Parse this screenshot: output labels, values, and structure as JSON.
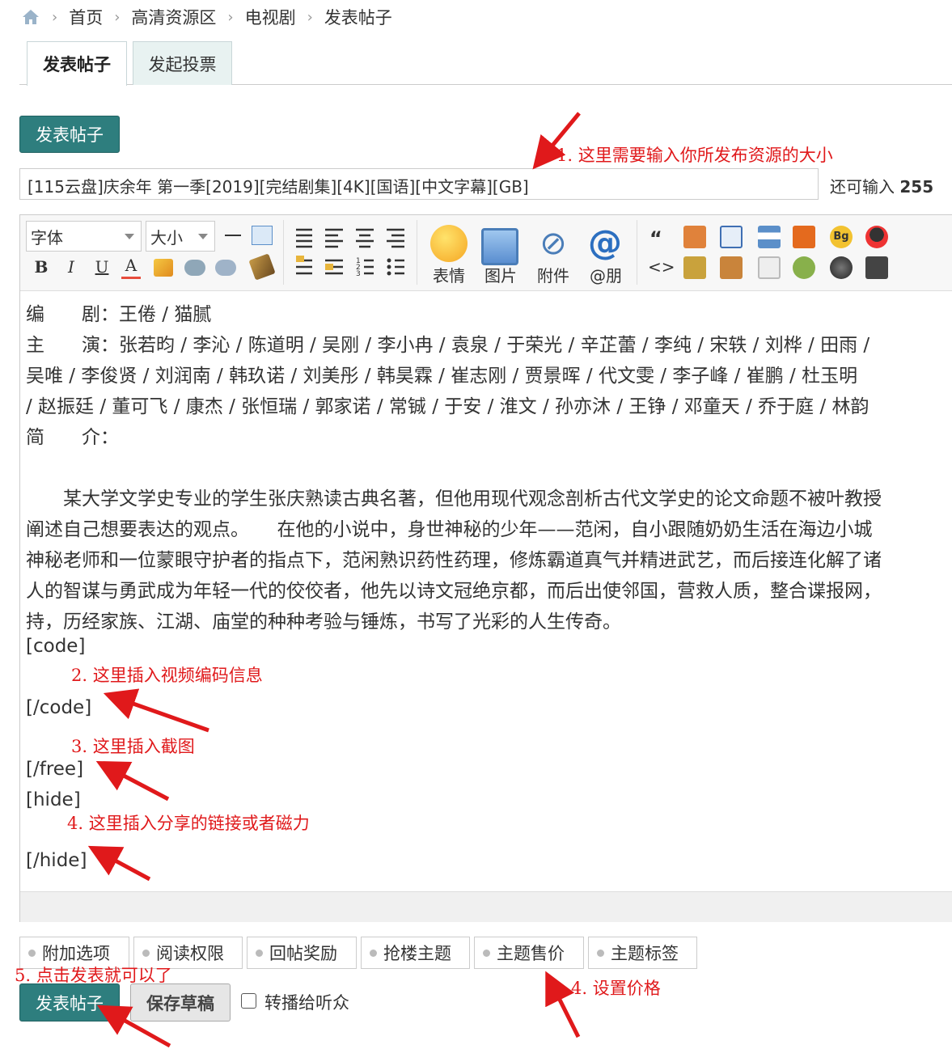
{
  "breadcrumb": [
    "首页",
    "高清资源区",
    "电视剧",
    "发表帖子"
  ],
  "icons": {
    "home": "home-icon"
  },
  "tabs": [
    {
      "label": "发表帖子",
      "active": true
    },
    {
      "label": "发起投票",
      "active": false
    }
  ],
  "post_type_button": "发表帖子",
  "title_input": {
    "value": "[115云盘]庆余年 第一季[2019][完结剧集][4K][国语][中文字幕][GB]"
  },
  "remaining": {
    "label": "还可输入",
    "count": "255"
  },
  "toolbar": {
    "font_select": "字体",
    "size_select": "大小",
    "big_buttons": [
      "表情",
      "图片",
      "附件",
      "@朋"
    ]
  },
  "content_lines": [
    "编　　剧：王倦 / 猫腻",
    "主　　演：张若昀 / 李沁 / 陈道明 / 吴刚 / 李小冉 / 袁泉 / 于荣光 / 辛芷蕾 / 李纯 / 宋轶 / 刘桦 / 田雨 /",
    "吴唯 / 李俊贤 / 刘润南 / 韩玖诺 / 刘美彤 / 韩昊霖 / 崔志刚 / 贾景晖 / 代文雯 / 李子峰 / 崔鹏 / 杜玉明",
    "/ 赵振廷 / 董可飞 / 康杰 / 张恒瑞 / 郭家诺 / 常铖 / 于安 / 淮文 / 孙亦沐 / 王铮 / 邓童天 / 乔于庭 / 林韵",
    "简　　介：",
    "",
    "　　某大学文学史专业的学生张庆熟读古典名著，但他用现代观念剖析古代文学史的论文命题不被叶教授",
    "阐述自己想要表达的观点。　　在他的小说中，身世神秘的少年——范闲，自小跟随奶奶生活在海边小城",
    "神秘老师和一位蒙眼守护者的指点下，范闲熟识药性药理，修炼霸道真气并精进武艺，而后接连化解了诸",
    "人的智谋与勇武成为年轻一代的佼佼者，他先以诗文冠绝京都，而后出使邻国，营救人质，整合谍报网，",
    "持，历经家族、江湖、庙堂的种种考验与锤炼，书写了光彩的人生传奇。"
  ],
  "tags": {
    "code_open": "[code]",
    "code_close": "[/code]",
    "free_close": "[/free]",
    "hide_open": "[hide]",
    "hide_close": "[/hide]"
  },
  "options": [
    "附加选项",
    "阅读权限",
    "回帖奖励",
    "抢楼主题",
    "主题售价",
    "主题标签"
  ],
  "actions": {
    "submit": "发表帖子",
    "draft": "保存草稿",
    "broadcast": "转播给听众"
  },
  "annotations": {
    "a1": "1. 这里需要输入你所发布资源的大小",
    "a2": "2. 这里插入视频编码信息",
    "a3": "3. 这里插入截图",
    "a4": "4. 这里插入分享的链接或者磁力",
    "a5": "5. 点击发表就可以了",
    "a6": "4. 设置价格"
  },
  "colors": {
    "accent": "#2e7e7e",
    "annotation": "#e0191b"
  }
}
